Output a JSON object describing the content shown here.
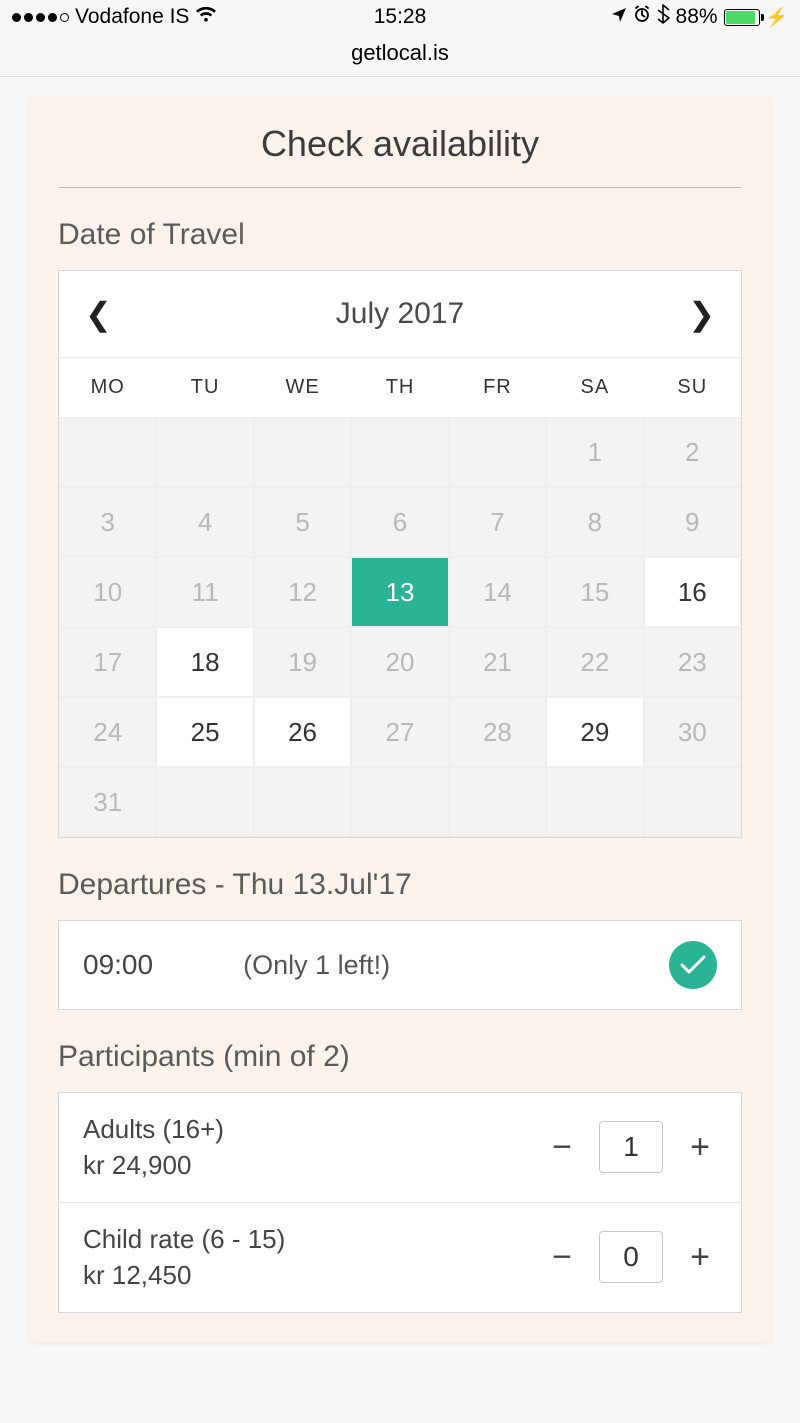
{
  "status": {
    "carrier": "Vodafone IS",
    "time": "15:28",
    "battery_pct": "88%"
  },
  "url": "getlocal.is",
  "card": {
    "title": "Check availability",
    "date_label": "Date of Travel",
    "month": "July 2017",
    "dow": [
      "MO",
      "TU",
      "WE",
      "TH",
      "FR",
      "SA",
      "SU"
    ],
    "cells": [
      {
        "d": "",
        "s": "blank"
      },
      {
        "d": "",
        "s": "blank"
      },
      {
        "d": "",
        "s": "blank"
      },
      {
        "d": "",
        "s": "blank"
      },
      {
        "d": "",
        "s": "blank"
      },
      {
        "d": "1",
        "s": "past"
      },
      {
        "d": "2",
        "s": "past"
      },
      {
        "d": "3",
        "s": "past"
      },
      {
        "d": "4",
        "s": "past"
      },
      {
        "d": "5",
        "s": "past"
      },
      {
        "d": "6",
        "s": "past"
      },
      {
        "d": "7",
        "s": "past"
      },
      {
        "d": "8",
        "s": "past"
      },
      {
        "d": "9",
        "s": "past"
      },
      {
        "d": "10",
        "s": "past"
      },
      {
        "d": "11",
        "s": "past"
      },
      {
        "d": "12",
        "s": "past"
      },
      {
        "d": "13",
        "s": "selected"
      },
      {
        "d": "14",
        "s": "past"
      },
      {
        "d": "15",
        "s": "past"
      },
      {
        "d": "16",
        "s": "avail"
      },
      {
        "d": "17",
        "s": "past"
      },
      {
        "d": "18",
        "s": "avail"
      },
      {
        "d": "19",
        "s": "past"
      },
      {
        "d": "20",
        "s": "past"
      },
      {
        "d": "21",
        "s": "past"
      },
      {
        "d": "22",
        "s": "past"
      },
      {
        "d": "23",
        "s": "past"
      },
      {
        "d": "24",
        "s": "past"
      },
      {
        "d": "25",
        "s": "avail"
      },
      {
        "d": "26",
        "s": "avail"
      },
      {
        "d": "27",
        "s": "past"
      },
      {
        "d": "28",
        "s": "past"
      },
      {
        "d": "29",
        "s": "avail"
      },
      {
        "d": "30",
        "s": "past"
      },
      {
        "d": "31",
        "s": "past"
      },
      {
        "d": "",
        "s": "blank"
      },
      {
        "d": "",
        "s": "blank"
      },
      {
        "d": "",
        "s": "blank"
      },
      {
        "d": "",
        "s": "blank"
      },
      {
        "d": "",
        "s": "blank"
      },
      {
        "d": "",
        "s": "blank"
      }
    ],
    "departures_label": "Departures - Thu 13.Jul'17",
    "departure": {
      "time": "09:00",
      "note": "(Only 1 left!)"
    },
    "participants_label": "Participants (min of 2)",
    "participants": [
      {
        "label": "Adults (16+)",
        "price": "kr 24,900",
        "count": "1"
      },
      {
        "label": "Child rate (6 - 15)",
        "price": "kr 12,450",
        "count": "0"
      }
    ]
  }
}
